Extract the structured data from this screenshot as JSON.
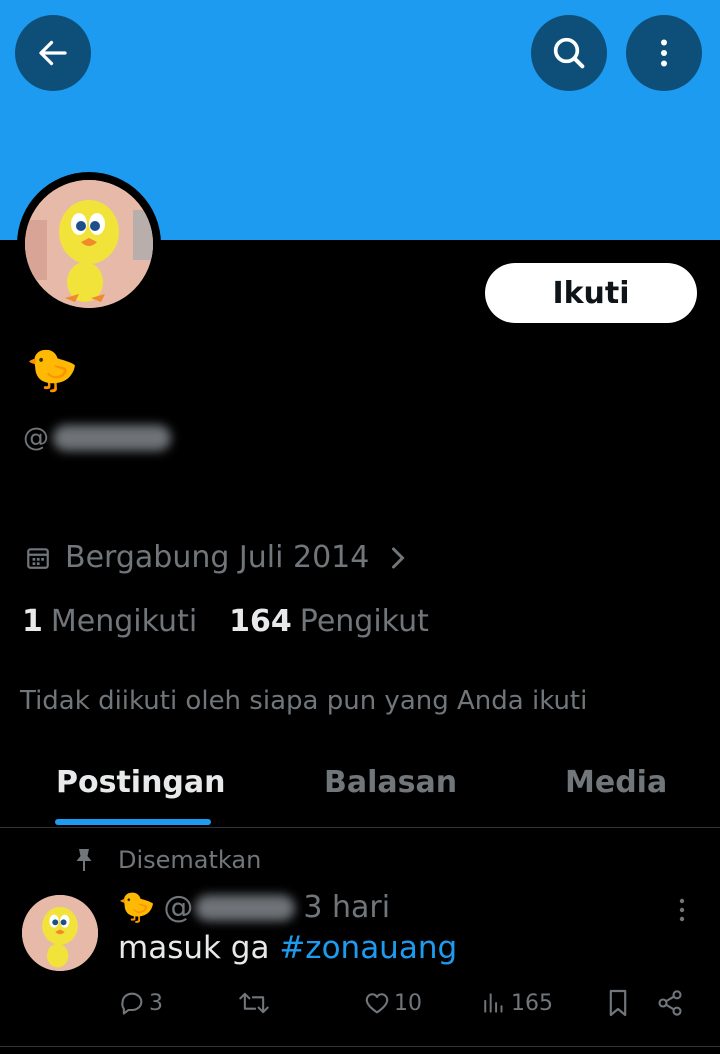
{
  "header": {
    "back_icon": "arrow-left-icon",
    "search_icon": "search-icon",
    "more_icon": "more-vertical-icon",
    "banner_color": "#1d9bf0"
  },
  "profile": {
    "display_name": "🐤",
    "handle_prefix": "@",
    "follow_label": "Ikuti",
    "joined": "Bergabung Juli 2014",
    "following_count": "1",
    "following_label": "Mengikuti",
    "followers_count": "164",
    "followers_label": "Pengikut",
    "not_followed_text": "Tidak diikuti oleh siapa pun yang Anda ikuti"
  },
  "tabs": [
    {
      "label": "Postingan",
      "active": true
    },
    {
      "label": "Balasan",
      "active": false
    },
    {
      "label": "Media",
      "active": false
    }
  ],
  "post": {
    "pinned_label": "Disematkan",
    "author_emoji": "🐤",
    "handle_prefix": "@",
    "time": "3 hari",
    "text": "masuk ga ",
    "hashtag": "#zonauang",
    "replies": "3",
    "likes": "10",
    "views": "165"
  },
  "colors": {
    "accent": "#1d9bf0",
    "muted": "#71767b",
    "text": "#e7e9ea"
  }
}
